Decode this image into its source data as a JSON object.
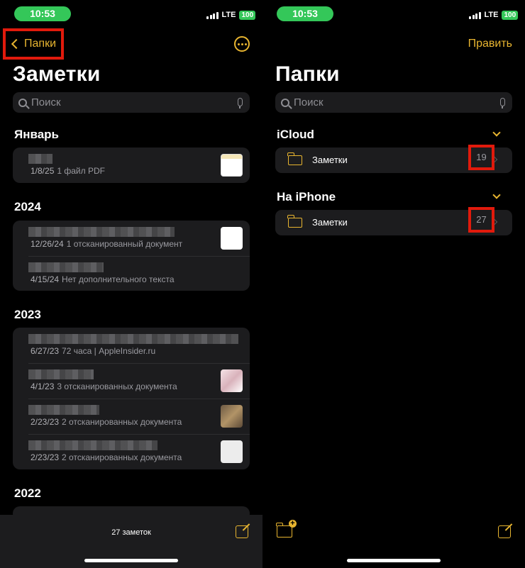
{
  "status": {
    "time": "10:53",
    "network": "LTE",
    "battery": "100"
  },
  "notes_screen": {
    "back_label": "Папки",
    "title": "Заметки",
    "search_placeholder": "Поиск",
    "sections": [
      {
        "heading": "Январь",
        "notes": [
          {
            "date": "1/8/25",
            "preview": "1 файл PDF",
            "thumb": "#efe6cf"
          }
        ]
      },
      {
        "heading": "2024",
        "notes": [
          {
            "date": "12/26/24",
            "preview": "1 отсканированный документ",
            "thumb": "#ffffff"
          },
          {
            "date": "4/15/24",
            "preview": "Нет дополнительного текста",
            "thumb": ""
          }
        ]
      },
      {
        "heading": "2023",
        "notes": [
          {
            "date": "6/27/23",
            "preview": "72 часа | AppleInsider.ru",
            "thumb": ""
          },
          {
            "date": "4/1/23",
            "preview": "3 отсканированных документа",
            "thumb": "#e8cfd4"
          },
          {
            "date": "2/23/23",
            "preview": "2 отсканированных документа",
            "thumb": "#9a7f5c"
          },
          {
            "date": "2/23/23",
            "preview": "2 отсканированных документа",
            "thumb": "#e9e9e9"
          }
        ]
      },
      {
        "heading": "2022",
        "notes": []
      }
    ],
    "note_count": "27 заметок"
  },
  "folders_screen": {
    "edit_label": "Править",
    "title": "Папки",
    "search_placeholder": "Поиск",
    "groups": [
      {
        "heading": "iCloud",
        "folder_name": "Заметки",
        "count": "19"
      },
      {
        "heading": "На iPhone",
        "folder_name": "Заметки",
        "count": "27"
      }
    ]
  },
  "colors": {
    "accent": "#e8b530",
    "highlight": "#e11a0c",
    "status_green": "#34c759"
  }
}
